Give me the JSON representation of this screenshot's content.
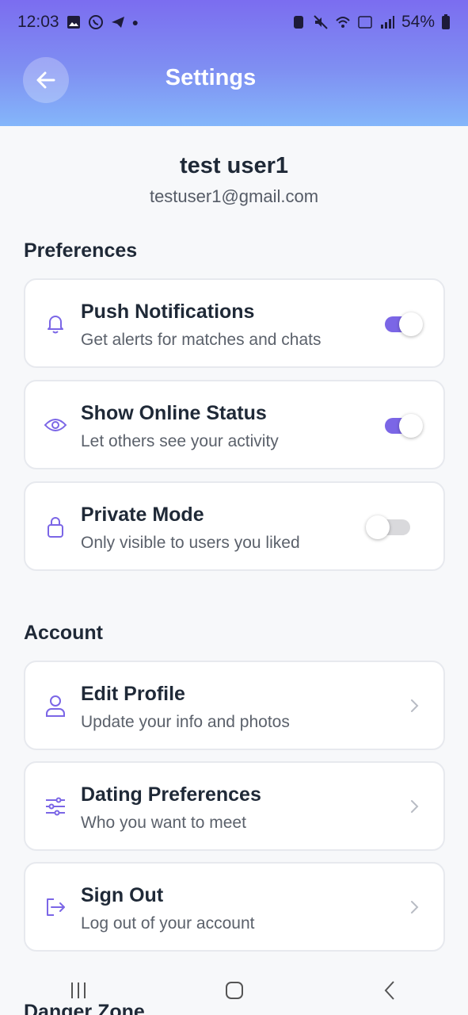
{
  "statusbar": {
    "time": "12:03",
    "battery": "54%"
  },
  "header": {
    "title": "Settings"
  },
  "user": {
    "name": "test user1",
    "email": "testuser1@gmail.com"
  },
  "preferences": {
    "title": "Preferences",
    "items": [
      {
        "title": "Push Notifications",
        "subtitle": "Get alerts for matches and chats",
        "icon": "bell-icon",
        "enabled": true
      },
      {
        "title": "Show Online Status",
        "subtitle": "Let others see your activity",
        "icon": "eye-icon",
        "enabled": true
      },
      {
        "title": "Private Mode",
        "subtitle": "Only visible to users you liked",
        "icon": "lock-icon",
        "enabled": false
      }
    ]
  },
  "account": {
    "title": "Account",
    "items": [
      {
        "title": "Edit Profile",
        "subtitle": "Update your info and photos",
        "icon": "user-icon"
      },
      {
        "title": "Dating Preferences",
        "subtitle": "Who you want to meet",
        "icon": "sliders-icon"
      },
      {
        "title": "Sign Out",
        "subtitle": "Log out of your account",
        "icon": "sign-out-icon"
      }
    ]
  },
  "danger": {
    "title": "Danger Zone"
  },
  "colors": {
    "accent": "#7b66e6",
    "header_top": "#7b6df0",
    "header_bottom": "#84b6fa"
  }
}
